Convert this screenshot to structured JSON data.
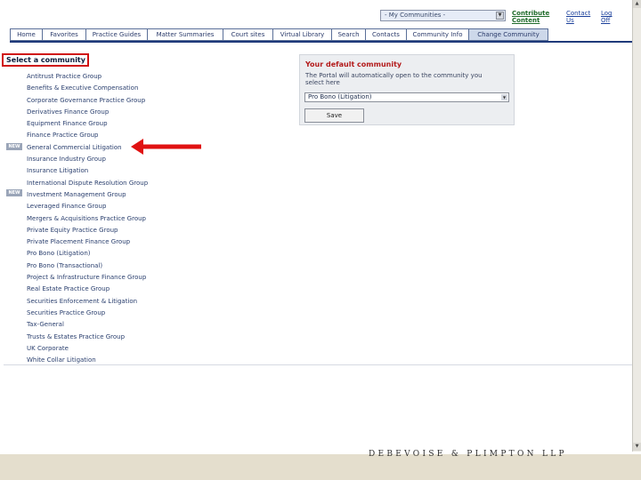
{
  "header": {
    "community_select": "- My Communities -",
    "links": {
      "contribute": "Contribute Content",
      "contact_us": "Contact Us",
      "log_off": "Log Off"
    }
  },
  "nav": {
    "tabs": [
      "Home",
      "Favorites",
      "Practice Guides",
      "Matter Summaries",
      "Court sites",
      "Virtual Library",
      "Search",
      "Contacts",
      "Community Info",
      "Change Community"
    ],
    "active": "Change Community"
  },
  "left": {
    "heading": "Select a community",
    "new_badge": "NEW",
    "communities": [
      "Antitrust Practice Group",
      "Benefits & Executive Compensation",
      "Corporate Governance Practice Group",
      "Derivatives Finance Group",
      "Equipment Finance Group",
      "Finance Practice Group",
      "General Commercial Litigation",
      "Insurance Industry Group",
      "Insurance Litigation",
      "International Dispute Resolution Group",
      "Investment Management Group",
      "Leveraged Finance Group",
      "Mergers & Acquisitions Practice Group",
      "Private Equity Practice Group",
      "Private Placement Finance Group",
      "Pro Bono (Litigation)",
      "Pro Bono (Transactional)",
      "Project & Infrastructure Finance Group",
      "Real Estate Practice Group",
      "Securities Enforcement & Litigation",
      "Securities Practice Group",
      "Tax-General",
      "Trusts & Estates Practice Group",
      "UK Corporate",
      "White Collar Litigation"
    ]
  },
  "panel": {
    "title": "Your default community",
    "description": "The Portal will automatically open to the community you select here",
    "selected": "Pro Bono (Litigation)",
    "save": "Save"
  },
  "footer": {
    "wordmark": "DEBEVOISE & PLIMPTON LLP"
  },
  "colors": {
    "highlight_red": "#d01010",
    "nav_active": "#cdd8ea",
    "nav_rule": "#1f3a7a",
    "footer_bar": "#e4decd"
  },
  "icons": {
    "arrow": "red-left-arrow",
    "dropdown": "chevron-down-icon"
  }
}
